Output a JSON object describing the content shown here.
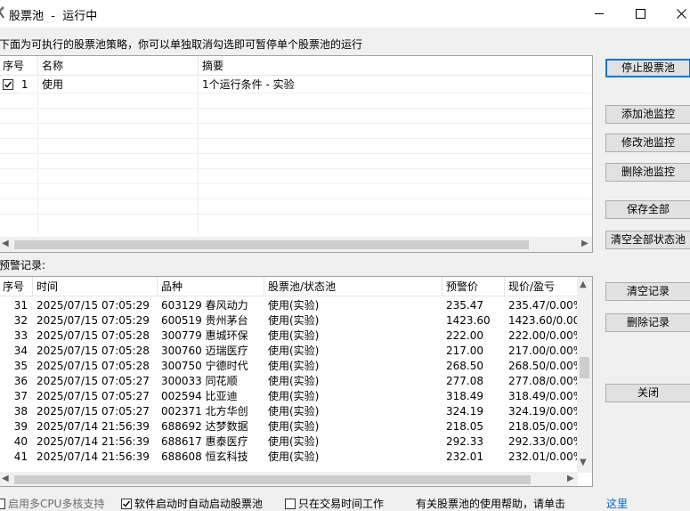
{
  "window": {
    "title": "股票池  -  运行中"
  },
  "description": "下面为可执行的股票池策略，你可以单独取消勾选即可暂停单个股票池的运行",
  "strategy_table": {
    "columns": [
      "序号",
      "名称",
      "摘要"
    ],
    "rows": [
      {
        "checked": true,
        "index": "1",
        "name": "使用",
        "summary": "1个运行条件 - 实验"
      }
    ]
  },
  "alert_label": "预警记录:",
  "alert_table": {
    "columns": [
      "序号",
      "时间",
      "品种",
      "股票池/状态池",
      "预警价",
      "现价/盈亏"
    ],
    "rows": [
      {
        "index": "31",
        "time": "2025/07/15 07:05:29",
        "symbol": "603129 春风动力",
        "pool": "使用(实验)",
        "alert_price": "235.47",
        "current": "235.47/0.00%"
      },
      {
        "index": "32",
        "time": "2025/07/15 07:05:29",
        "symbol": "600519 贵州茅台",
        "pool": "使用(实验)",
        "alert_price": "1423.60",
        "current": "1423.60/0.00%"
      },
      {
        "index": "33",
        "time": "2025/07/15 07:05:28",
        "symbol": "300779 惠城环保",
        "pool": "使用(实验)",
        "alert_price": "222.00",
        "current": "222.00/0.00%"
      },
      {
        "index": "34",
        "time": "2025/07/15 07:05:28",
        "symbol": "300760 迈瑞医疗",
        "pool": "使用(实验)",
        "alert_price": "217.00",
        "current": "217.00/0.00%"
      },
      {
        "index": "35",
        "time": "2025/07/15 07:05:28",
        "symbol": "300750 宁德时代",
        "pool": "使用(实验)",
        "alert_price": "268.50",
        "current": "268.50/0.00%"
      },
      {
        "index": "36",
        "time": "2025/07/15 07:05:27",
        "symbol": "300033 同花顺",
        "pool": "使用(实验)",
        "alert_price": "277.08",
        "current": "277.08/0.00%"
      },
      {
        "index": "37",
        "time": "2025/07/15 07:05:27",
        "symbol": "002594 比亚迪",
        "pool": "使用(实验)",
        "alert_price": "318.49",
        "current": "318.49/0.00%"
      },
      {
        "index": "38",
        "time": "2025/07/15 07:05:27",
        "symbol": "002371 北方华创",
        "pool": "使用(实验)",
        "alert_price": "324.19",
        "current": "324.19/0.00%"
      },
      {
        "index": "39",
        "time": "2025/07/14 21:56:39",
        "symbol": "688692 达梦数据",
        "pool": "使用(实验)",
        "alert_price": "218.05",
        "current": "218.05/0.00%"
      },
      {
        "index": "40",
        "time": "2025/07/14 21:56:39",
        "symbol": "688617 惠泰医疗",
        "pool": "使用(实验)",
        "alert_price": "292.33",
        "current": "292.33/0.00%"
      },
      {
        "index": "41",
        "time": "2025/07/14 21:56:39",
        "symbol": "688608 恒玄科技",
        "pool": "使用(实验)",
        "alert_price": "232.01",
        "current": "232.01/0.00%"
      }
    ]
  },
  "buttons": {
    "stop_pool": "停止股票池",
    "add_monitor": "添加池监控",
    "edit_monitor": "修改池监控",
    "delete_monitor": "删除池监控",
    "save_all": "保存全部",
    "clear_status": "清空全部状态池",
    "clear_records": "清空记录",
    "delete_record": "删除记录",
    "close": "关闭"
  },
  "footer": {
    "multicore": {
      "label": "启用多CPU多核支持",
      "checked": false
    },
    "autostart": {
      "label": "软件启动时自动启动股票池",
      "checked": true
    },
    "trading_hours": {
      "label": "只在交易时间工作",
      "checked": false
    },
    "help_text": "有关股票池的使用帮助，请单击",
    "help_link": "这里"
  }
}
